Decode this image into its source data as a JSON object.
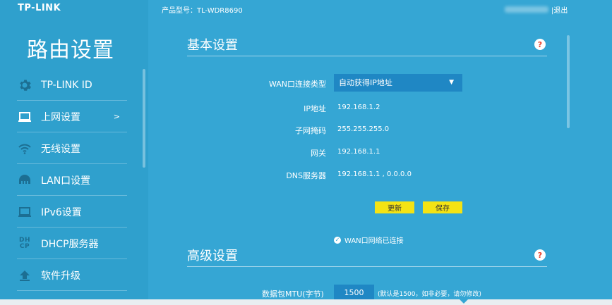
{
  "brand": {
    "logo": "TP-LINK"
  },
  "sidebar": {
    "title": "路由设置",
    "items": [
      {
        "label": "TP-LINK ID",
        "icon": "gear-icon"
      },
      {
        "label": "上网设置",
        "icon": "monitor-icon",
        "arrow": ">"
      },
      {
        "label": "无线设置",
        "icon": "wifi-icon"
      },
      {
        "label": "LAN口设置",
        "icon": "lan-icon"
      },
      {
        "label": "IPv6设置",
        "icon": "monitor-icon"
      },
      {
        "label": "DHCP服务器",
        "icon": "dhcp-icon",
        "glyph_top": "DH",
        "glyph_bottom": "CP"
      },
      {
        "label": "软件升级",
        "icon": "upload-icon"
      }
    ]
  },
  "header": {
    "model": "产品型号：TL-WDR8690",
    "logout": "|退出"
  },
  "basic": {
    "title": "基本设置",
    "help": "?",
    "wan_type_label": "WAN口连接类型",
    "wan_type_value": "自动获得IP地址",
    "ip_label": "IP地址",
    "ip_value": "192.168.1.2",
    "mask_label": "子网掩码",
    "mask_value": "255.255.255.0",
    "gateway_label": "网关",
    "gateway_value": "192.168.1.1",
    "dns_label": "DNS服务器",
    "dns_value": "192.168.1.1 , 0.0.0.0",
    "refresh_label": "更新",
    "save_label": "保存",
    "status_text": "WAN口网络已连接"
  },
  "advanced": {
    "title": "高级设置",
    "help": "?",
    "mtu_label": "数据包MTU(字节)",
    "mtu_value": "1500",
    "mtu_hint": "(默认是1500，如非必要，请勿修改)"
  },
  "colors": {
    "background": "#35a6d4",
    "button": "#f4e314",
    "input": "#1f87c4",
    "help": "#e8412c"
  }
}
